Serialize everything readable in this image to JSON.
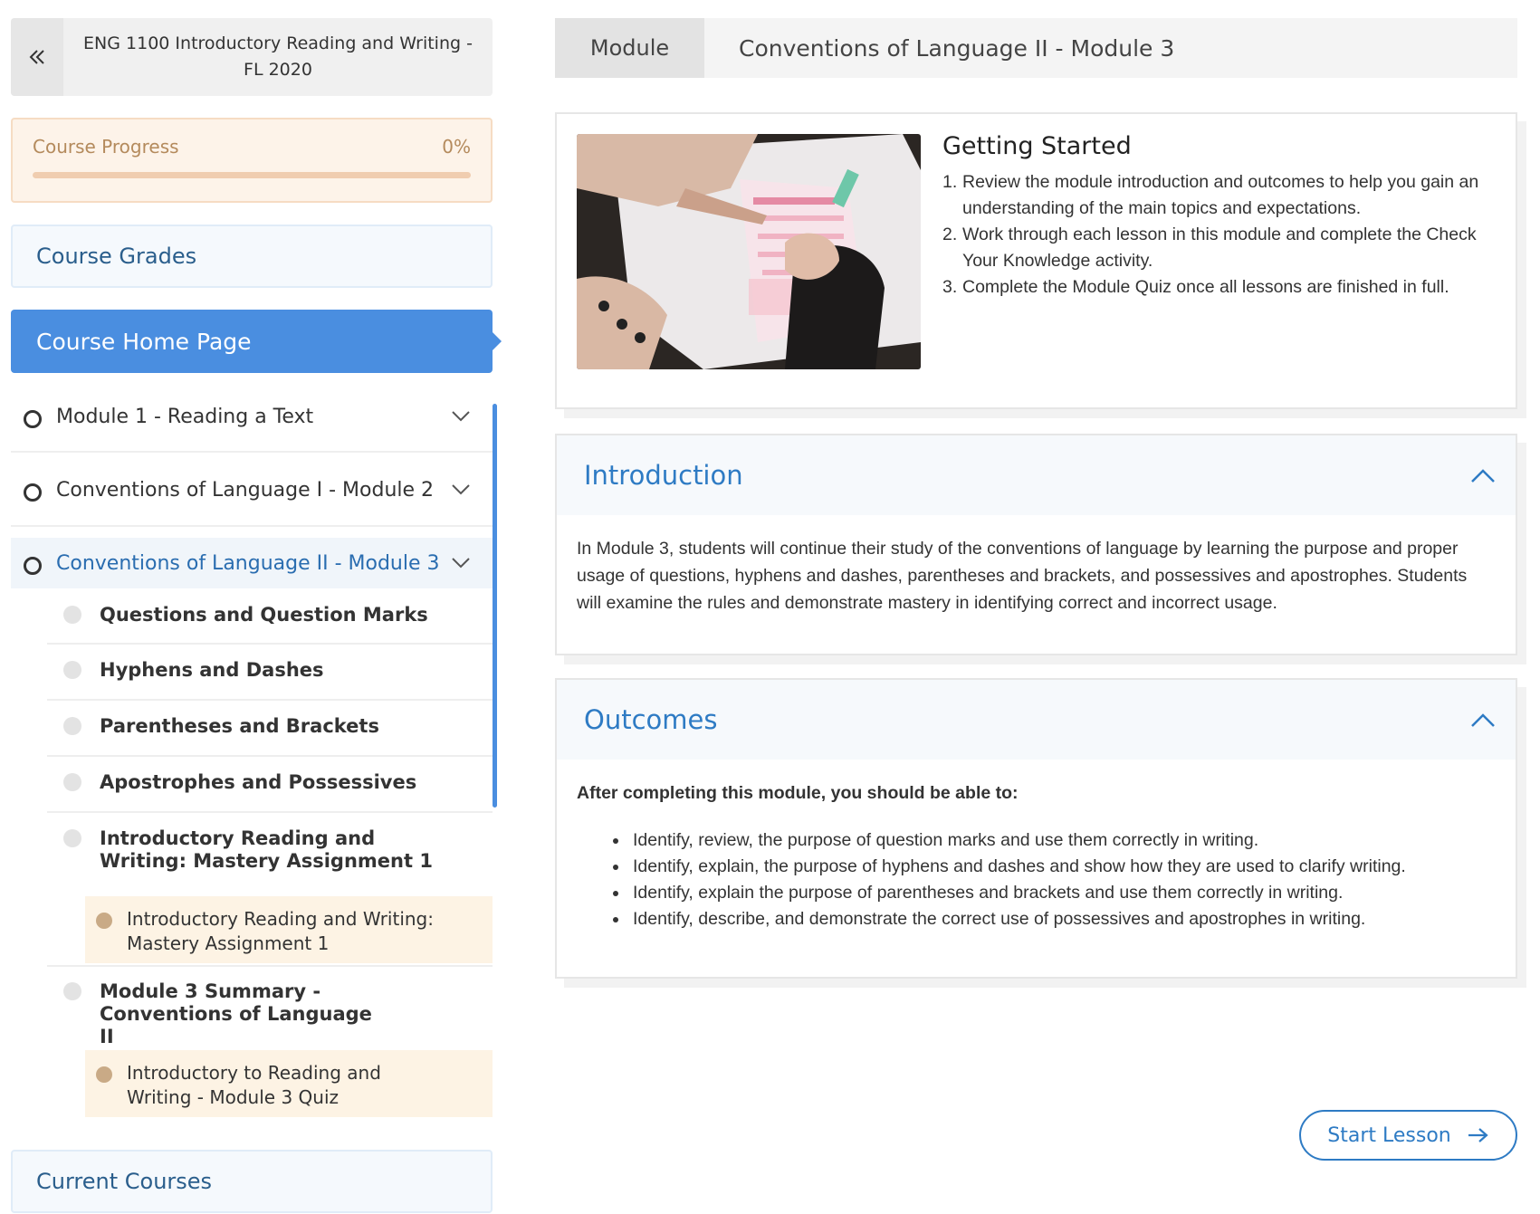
{
  "sidebar": {
    "course_title": "ENG 1100 Introductory Reading and Writing - FL 2020",
    "progress": {
      "label": "Course Progress",
      "value_text": "0%",
      "fraction": 0.0
    },
    "grades_label": "Course Grades",
    "home_label": "Course Home Page",
    "modules": [
      {
        "label": "Module 1 - Reading a Text"
      },
      {
        "label": "Conventions of Language I - Module 2"
      },
      {
        "label": "Conventions of Language II - Module 3"
      }
    ],
    "lessons": [
      {
        "label": "Questions and Question Marks"
      },
      {
        "label": "Hyphens and Dashes"
      },
      {
        "label": "Parentheses and Brackets"
      },
      {
        "label": "Apostrophes and Possessives"
      },
      {
        "label": "Introductory Reading and Writing: Mastery Assignment 1"
      },
      {
        "label": "Module 3 Summary - Conventions of Language II"
      }
    ],
    "quizzes": [
      {
        "label": "Introductory Reading and Writing: Mastery Assignment 1"
      },
      {
        "label": "Introductory to Reading and Writing - Module 3 Quiz"
      }
    ],
    "current_courses_label": "Current Courses"
  },
  "header": {
    "tab_label": "Module",
    "title": "Conventions of Language II - Module 3"
  },
  "getting_started": {
    "title": "Getting Started",
    "items": [
      "Review the module introduction and outcomes to help you gain an understanding of the main topics and expectations.",
      "Work through each lesson in this module and complete the Check Your Knowledge activity.",
      "Complete the Module Quiz once all lessons are finished in full."
    ],
    "numbers": [
      "1.",
      "2.",
      "3."
    ]
  },
  "introduction": {
    "title": "Introduction",
    "text": "In Module 3, students will continue their study of the conventions of language by learning the purpose and proper usage of questions, hyphens and dashes, parentheses and brackets, and possessives and apostrophes. Students will examine the rules and demonstrate mastery in identifying correct and incorrect usage."
  },
  "outcomes": {
    "title": "Outcomes",
    "lead": "After completing this module, you should be able to:",
    "items": [
      "Identify, review, the purpose of question marks and use them correctly in writing.",
      "Identify, explain, the purpose of hyphens and dashes and show how they are used to clarify writing.",
      "Identify, explain the purpose of parentheses and brackets and use them correctly in writing.",
      "Identify, describe, and demonstrate the correct use of possessives and apostrophes in writing."
    ]
  },
  "start_button": {
    "label": "Start Lesson"
  },
  "colors": {
    "accent": "#4a8ee0",
    "link": "#2e7bc4",
    "progress_bg": "#fdf3e9",
    "quiz_bg": "#fdf3e4"
  },
  "icons": [
    "double-chevron-left-icon",
    "chevron-down-icon",
    "chevron-up-icon",
    "arrow-right-icon"
  ]
}
